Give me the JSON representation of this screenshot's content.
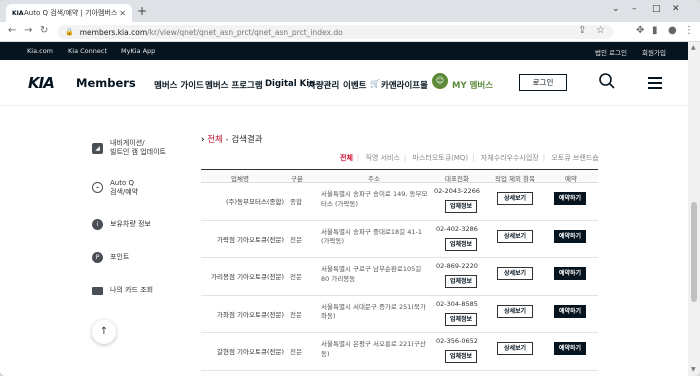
{
  "browser": {
    "tab_title": "Auto Q 검색/예약 | 기아멤버스",
    "tab_favicon": "KIA",
    "url_host": "members.kia.com",
    "url_path": "/kr/view/qnet/qnet_asn_prct/qnet_asn_prct_index.do"
  },
  "topbar": {
    "links": [
      "Kia.com",
      "Kia Connect",
      "MyKia App"
    ],
    "right_links": [
      "법인 로그인",
      "회원가입"
    ]
  },
  "header": {
    "logo": "KIA",
    "brand": "Members",
    "menu": [
      "멤버스 가이드",
      "멤버스 프로그램",
      "Digital Kia",
      "차량관리",
      "이벤트",
      "카앤라이프몰"
    ],
    "my_label": "MY 멤버스",
    "login": "로그인"
  },
  "sidebar": {
    "items": [
      {
        "label1": "내비게이션/",
        "label2": "빌트인 캠 업데이트",
        "icon": "navigation-icon"
      },
      {
        "label1": "Auto Q",
        "label2": "검색/예약",
        "icon": "location-icon"
      },
      {
        "label1": "보유차량 정보",
        "label2": "",
        "icon": "car-info-icon"
      },
      {
        "label1": "포인트",
        "label2": "",
        "icon": "point-icon"
      },
      {
        "label1": "나의 카드 조회",
        "label2": "",
        "icon": "card-icon"
      }
    ]
  },
  "content": {
    "crumb_hl": "전체",
    "crumb_rest": " - 검색결과",
    "filters": [
      "전체",
      "직영 서비스",
      "마스터오토큐(MQ)",
      "자체수리우수사업장",
      "오토큐 브랜드숍"
    ],
    "columns": [
      "업체명",
      "구분",
      "주소",
      "대표전화",
      "작업 제외 항목",
      "예약"
    ],
    "info_label": "업체정보",
    "detail_label": "상세보기",
    "book_label": "예약하기",
    "rows": [
      {
        "name": "(주)동부모터스(종합)",
        "kind": "종합",
        "addr": "서울특별시 송파구 송이로 149, 동부모터스 (가락동)",
        "tel": "02-2043-2266"
      },
      {
        "name": "가락점 기아오토큐(전문)",
        "kind": "전문",
        "addr": "서울특별시 송파구 중대로18길 41-1 (가락동)",
        "tel": "02-402-3286"
      },
      {
        "name": "가리봉점 기아오토큐(전문)",
        "kind": "전문",
        "addr": "서울특별시 구로구 남부순환로105길 80 가리봉동",
        "tel": "02-869-2220"
      },
      {
        "name": "가좌점 기아오토큐(전문)",
        "kind": "전문",
        "addr": "서울특별시 서대문구 증가로 251(북가좌동)",
        "tel": "02-304-8585"
      },
      {
        "name": "갈현점 기아오토큐(전문)",
        "kind": "전문",
        "addr": "서울특별시 은평구 서오릉로 221(구산동)",
        "tel": "02-356-0652"
      }
    ]
  }
}
